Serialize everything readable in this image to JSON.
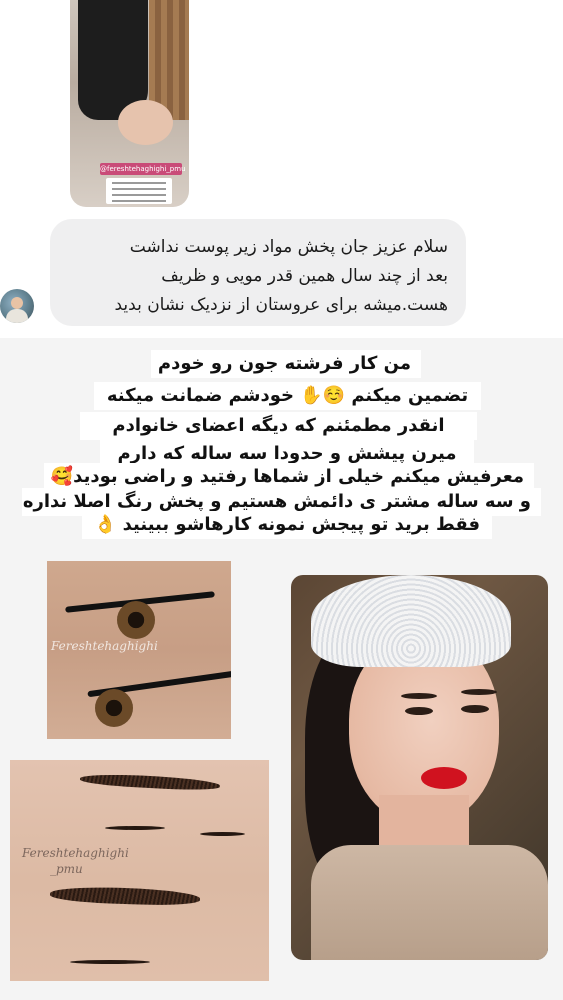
{
  "story": {
    "handle": "@fereshtehaghighi_pmu"
  },
  "message": {
    "lines": [
      "سلام عزیز جان  پخش مواد زیر پوست نداشت",
      "بعد از چند سال همین قدر مویی و ظریف",
      "هست.میشه برای عروستان از نزدیک نشان بدید"
    ]
  },
  "caption": {
    "lines": [
      "من کار فرشته جون رو خودم",
      "تضمین میکنم ☺️✋ خودشم ضمانت میکنه",
      "انقدر مطمئنم که دیگه اعضای خانوادم",
      "میرن پیشش  و حدودا سه ساله که دارم",
      "معرفیش میکنم خیلی از شماها رفتید و راضی بودید🥰",
      "و سه ساله مشتر ی دائمش هستیم و پخش رنگ اصلا نداره",
      "فقط برید تو پیجش نمونه کارهاشو ببینید 👌"
    ]
  },
  "watermarks": {
    "eyeliner": "Fereshtehaghighi",
    "brows_line1": "Fereshtehaghighi",
    "brows_line2": "_pmu"
  }
}
